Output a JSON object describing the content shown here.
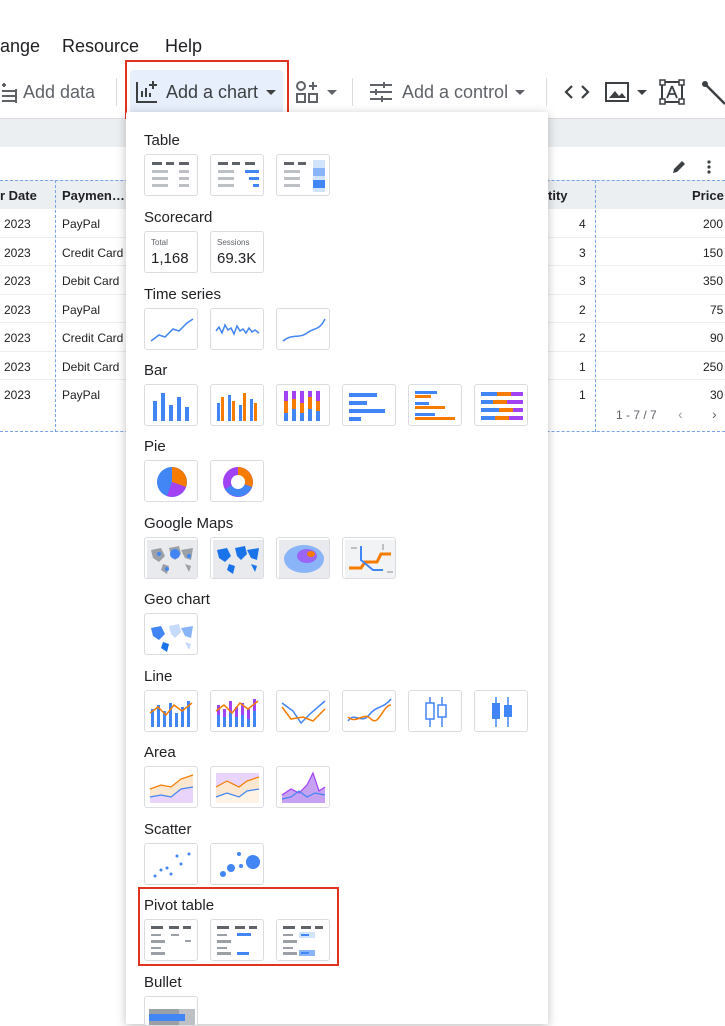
{
  "menu": {
    "items": [
      "ange",
      "Resource",
      "Help"
    ]
  },
  "toolbar": {
    "add_data": "Add data",
    "add_chart": "Add a chart",
    "add_control": "Add a control"
  },
  "table": {
    "headers": [
      "r Date",
      "Paymen…",
      "tity",
      "Price"
    ],
    "rows": [
      {
        "year": "2023",
        "payment": "PayPal",
        "qty": "4",
        "price": "200"
      },
      {
        "year": "2023",
        "payment": "Credit Card",
        "qty": "3",
        "price": "150"
      },
      {
        "year": "2023",
        "payment": "Debit Card",
        "qty": "3",
        "price": "350"
      },
      {
        "year": "2023",
        "payment": "PayPal",
        "qty": "2",
        "price": "75"
      },
      {
        "year": "2023",
        "payment": "Credit Card",
        "qty": "2",
        "price": "90"
      },
      {
        "year": "2023",
        "payment": "Debit Card",
        "qty": "1",
        "price": "250"
      },
      {
        "year": "2023",
        "payment": "PayPal",
        "qty": "1",
        "price": "30"
      }
    ],
    "pagination": "1 - 7 / 7"
  },
  "chart_menu": {
    "sections": [
      {
        "label": "Table"
      },
      {
        "label": "Scorecard"
      },
      {
        "label": "Time series"
      },
      {
        "label": "Bar"
      },
      {
        "label": "Pie"
      },
      {
        "label": "Google Maps"
      },
      {
        "label": "Geo chart"
      },
      {
        "label": "Line"
      },
      {
        "label": "Area"
      },
      {
        "label": "Scatter"
      },
      {
        "label": "Pivot table"
      },
      {
        "label": "Bullet"
      }
    ],
    "scorecards": [
      {
        "caption": "Total",
        "value": "1,168"
      },
      {
        "caption": "Sessions",
        "value": "69.3K"
      }
    ]
  },
  "colors": {
    "accent_blue": "#4285f4",
    "accent_orange": "#f57c00",
    "accent_purple": "#a142f4",
    "highlight_red": "#e0331f"
  }
}
